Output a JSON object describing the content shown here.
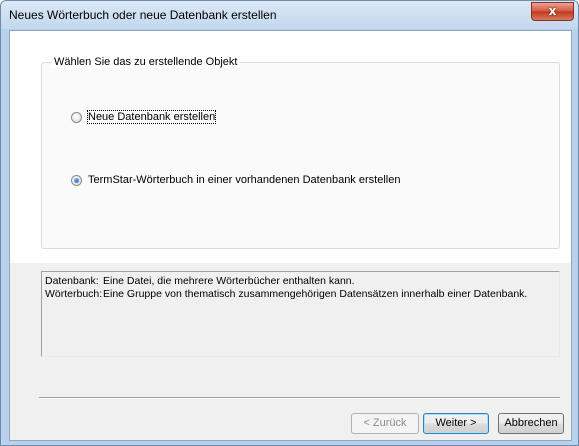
{
  "window": {
    "title": "Neues Wörterbuch oder neue Datenbank erstellen",
    "close_glyph": "x"
  },
  "group": {
    "label": "Wählen Sie das zu erstellende Objekt"
  },
  "options": [
    {
      "label": "Neue Datenbank erstellen",
      "checked": false
    },
    {
      "label": "TermStar-Wörterbuch in einer vorhandenen Datenbank erstellen",
      "checked": true
    }
  ],
  "description": [
    {
      "term": "Datenbank:",
      "definition": "Eine Datei, die mehrere Wörterbücher enthalten kann."
    },
    {
      "term": "Wörterbuch:",
      "definition": "Eine Gruppe von thematisch zusammengehörigen Datensätzen innerhalb einer Datenbank."
    }
  ],
  "buttons": {
    "back_label": "< Zurück",
    "next_label": "Weiter >",
    "cancel_label": "Abbrechen"
  }
}
